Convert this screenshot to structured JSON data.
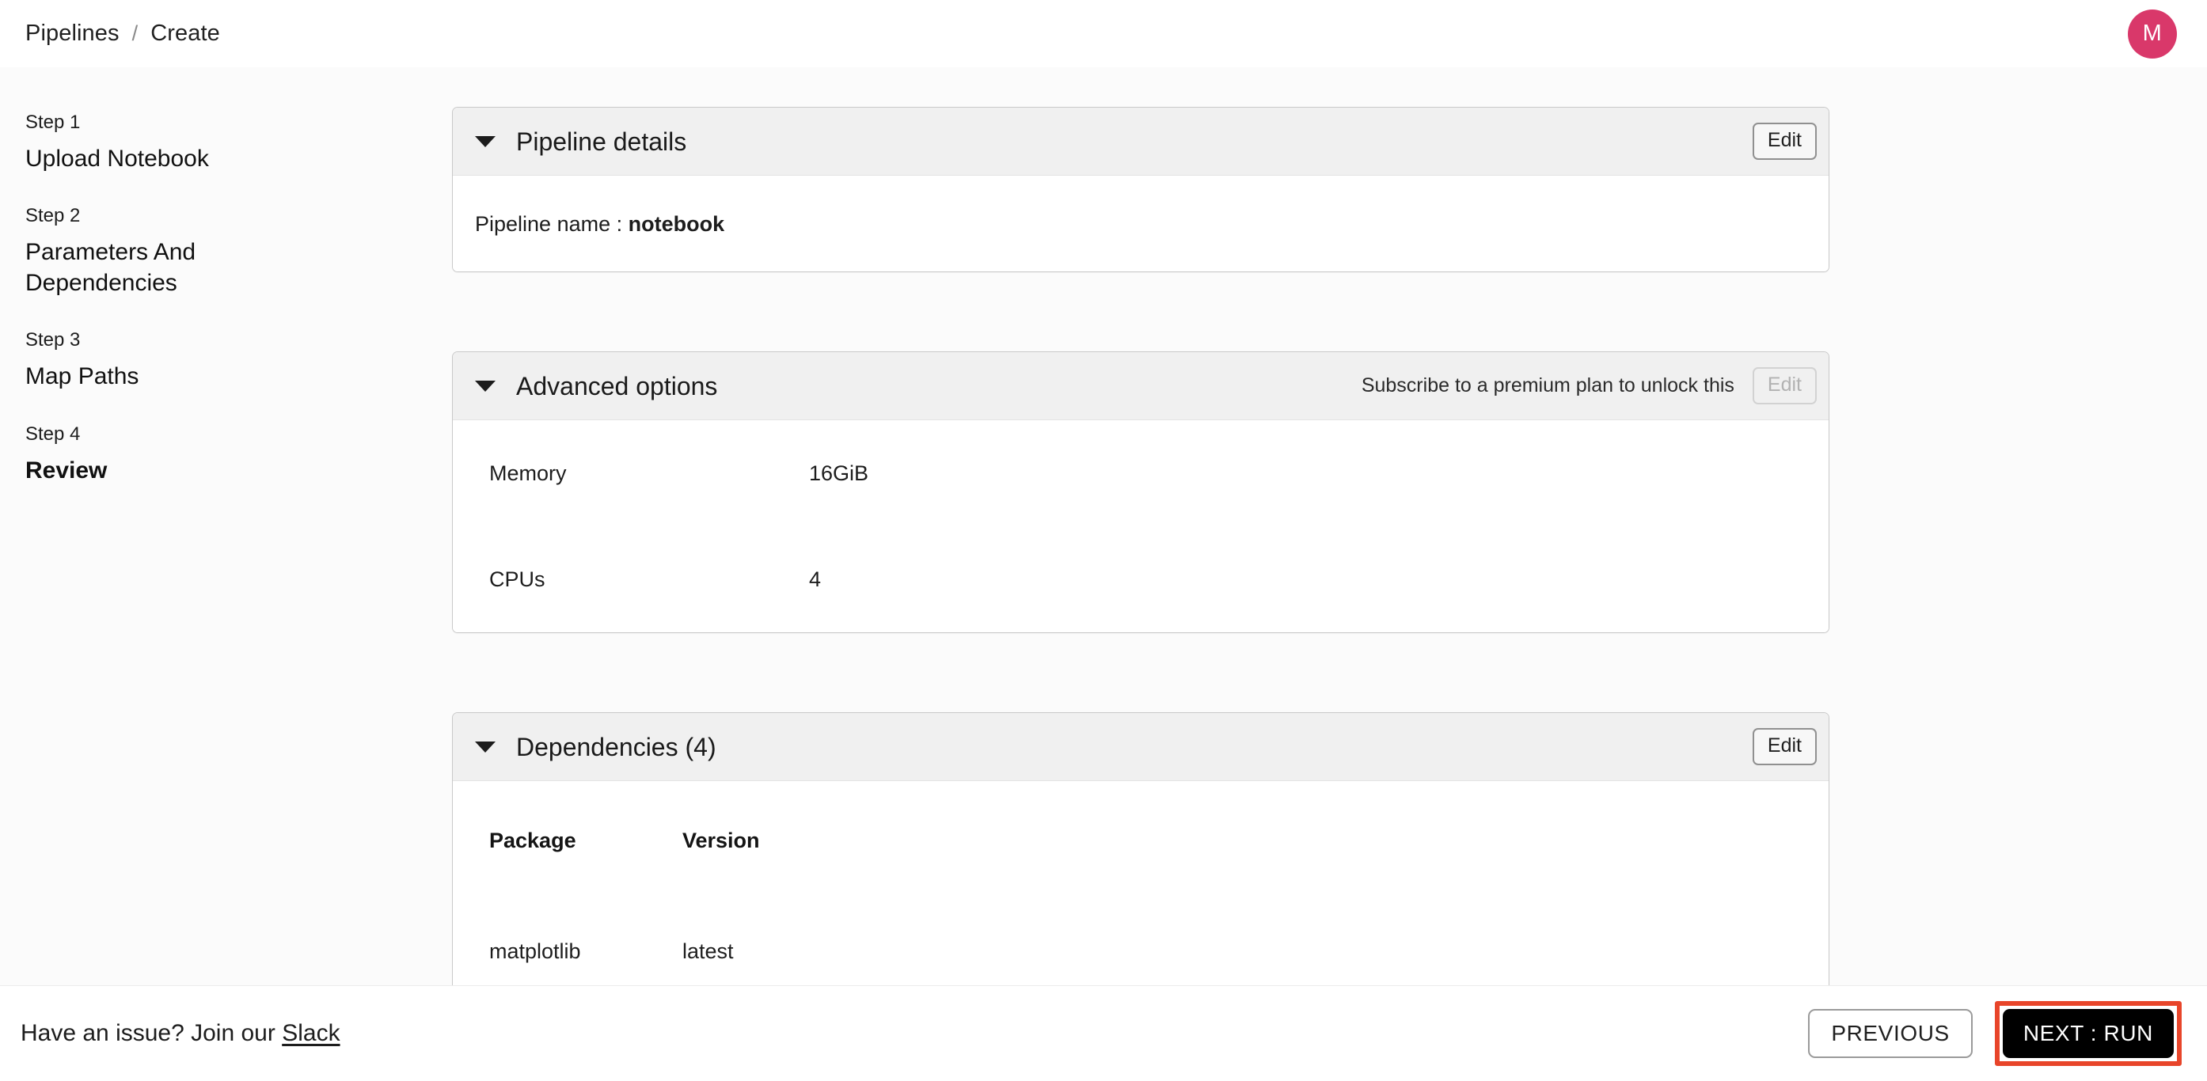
{
  "header": {
    "breadcrumb": {
      "root": "Pipelines",
      "separator": "/",
      "current": "Create"
    },
    "avatar_initial": "M",
    "avatar_color": "#d9386a"
  },
  "stepper": {
    "steps": [
      {
        "number": "Step 1",
        "label": "Upload Notebook",
        "active": false
      },
      {
        "number": "Step 2",
        "label": "Parameters And Dependencies",
        "active": false
      },
      {
        "number": "Step 3",
        "label": "Map Paths",
        "active": false
      },
      {
        "number": "Step 4",
        "label": "Review",
        "active": true
      }
    ]
  },
  "cards": {
    "pipeline_details": {
      "title": "Pipeline details",
      "edit_label": "Edit",
      "name_label": "Pipeline name :",
      "name_value": "notebook"
    },
    "advanced_options": {
      "title": "Advanced options",
      "premium_note": "Subscribe to a premium plan to unlock this",
      "edit_label": "Edit",
      "rows": [
        {
          "key": "Memory",
          "value": "16GiB"
        },
        {
          "key": "CPUs",
          "value": "4"
        }
      ]
    },
    "dependencies": {
      "title": "Dependencies (4)",
      "edit_label": "Edit",
      "columns": [
        "Package",
        "Version"
      ],
      "rows": [
        {
          "package": "matplotlib",
          "version": "latest"
        }
      ]
    }
  },
  "footer": {
    "note_prefix": "Have an issue? Join our",
    "slack_link": "Slack",
    "previous_label": "PREVIOUS",
    "next_label": "NEXT : RUN",
    "highlight_color": "#e8452a"
  }
}
